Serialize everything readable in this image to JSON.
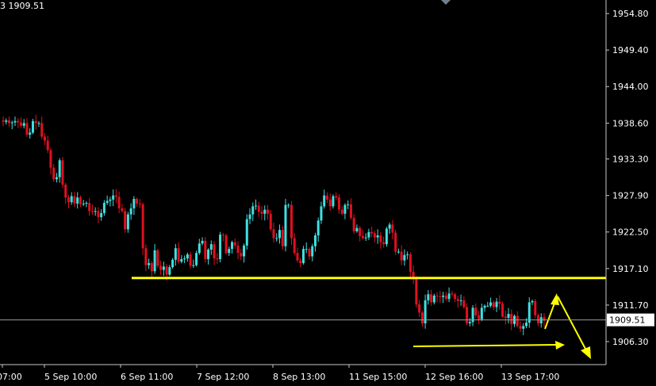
{
  "header": {
    "text": "3 1909.51"
  },
  "chart_data": {
    "type": "candlestick",
    "xlabel": "",
    "ylabel": "",
    "ylim": [
      1902.9,
      1956.8
    ],
    "y_ticks": [
      "1954.80",
      "1949.40",
      "1944.00",
      "1938.60",
      "1933.30",
      "1927.90",
      "1922.50",
      "1917.10",
      "1911.70",
      "1906.30"
    ],
    "x_ticks": [
      "07:00",
      "5 Sep 10:00",
      "6 Sep 11:00",
      "7 Sep 12:00",
      "8 Sep 13:00",
      "11 Sep 15:00",
      "12 Sep 16:00",
      "13 Sep 17:00"
    ],
    "current_price": "1909.51",
    "bull_color": "#40e0e0",
    "bear_color": "#e01020",
    "annotation_color": "#ffff00",
    "support_level": 1915.7,
    "closes": [
      1938.8,
      1939.0,
      1938.6,
      1938.7,
      1938.9,
      1938.7,
      1938.2,
      1938.6,
      1936.9,
      1937.2,
      1938.9,
      1938.6,
      1938.6,
      1936.6,
      1936.0,
      1934.6,
      1932.0,
      1930.3,
      1930.6,
      1933.1,
      1929.5,
      1927.6,
      1926.9,
      1927.8,
      1926.7,
      1927.6,
      1926.6,
      1926.7,
      1926.8,
      1925.6,
      1925.5,
      1925.6,
      1924.7,
      1925.3,
      1926.8,
      1927.1,
      1927.3,
      1927.9,
      1927.7,
      1926.0,
      1925.6,
      1922.9,
      1925.1,
      1926.0,
      1927.4,
      1926.7,
      1926.6,
      1920.1,
      1917.6,
      1917.9,
      1916.7,
      1919.8,
      1917.5,
      1916.9,
      1917.4,
      1916.2,
      1917.3,
      1918.4,
      1920.1,
      1918.1,
      1918.5,
      1918.6,
      1919.2,
      1917.5,
      1917.6,
      1919.4,
      1920.8,
      1921.2,
      1918.5,
      1919.9,
      1920.7,
      1918.6,
      1918.5,
      1922.1,
      1922.0,
      1919.4,
      1920.0,
      1921.0,
      1920.5,
      1919.4,
      1918.9,
      1920.5,
      1924.4,
      1925.1,
      1926.3,
      1926.4,
      1925.5,
      1925.2,
      1925.8,
      1925.2,
      1922.9,
      1921.6,
      1921.6,
      1922.8,
      1920.4,
      1926.5,
      1926.5,
      1921.6,
      1919.4,
      1918.3,
      1917.9,
      1920.0,
      1920.0,
      1918.9,
      1920.4,
      1922.0,
      1924.2,
      1926.3,
      1927.9,
      1927.3,
      1926.3,
      1927.8,
      1927.6,
      1925.8,
      1925.2,
      1926.5,
      1926.6,
      1924.6,
      1922.6,
      1923.1,
      1921.9,
      1921.6,
      1921.7,
      1922.5,
      1922.3,
      1921.7,
      1922.0,
      1921.0,
      1920.7,
      1923.0,
      1923.6,
      1922.4,
      1919.6,
      1919.6,
      1918.3,
      1919.1,
      1919.2,
      1916.6,
      1915.5,
      1911.8,
      1910.6,
      1909.0,
      1912.4,
      1913.3,
      1912.1,
      1913.1,
      1913.0,
      1912.9,
      1913.1,
      1912.6,
      1913.4,
      1913.3,
      1912.6,
      1912.3,
      1912.4,
      1911.4,
      1909.0,
      1909.2,
      1911.3,
      1910.2,
      1909.6,
      1911.3,
      1911.6,
      1911.6,
      1912.1,
      1911.4,
      1912.2,
      1911.9,
      1910.0,
      1909.8,
      1910.4,
      1908.9,
      1910.1,
      1908.6,
      1908.2,
      1908.6,
      1909.1,
      1912.1,
      1912.3,
      1910.2,
      1909.0,
      1909.9,
      1909.4
    ]
  }
}
